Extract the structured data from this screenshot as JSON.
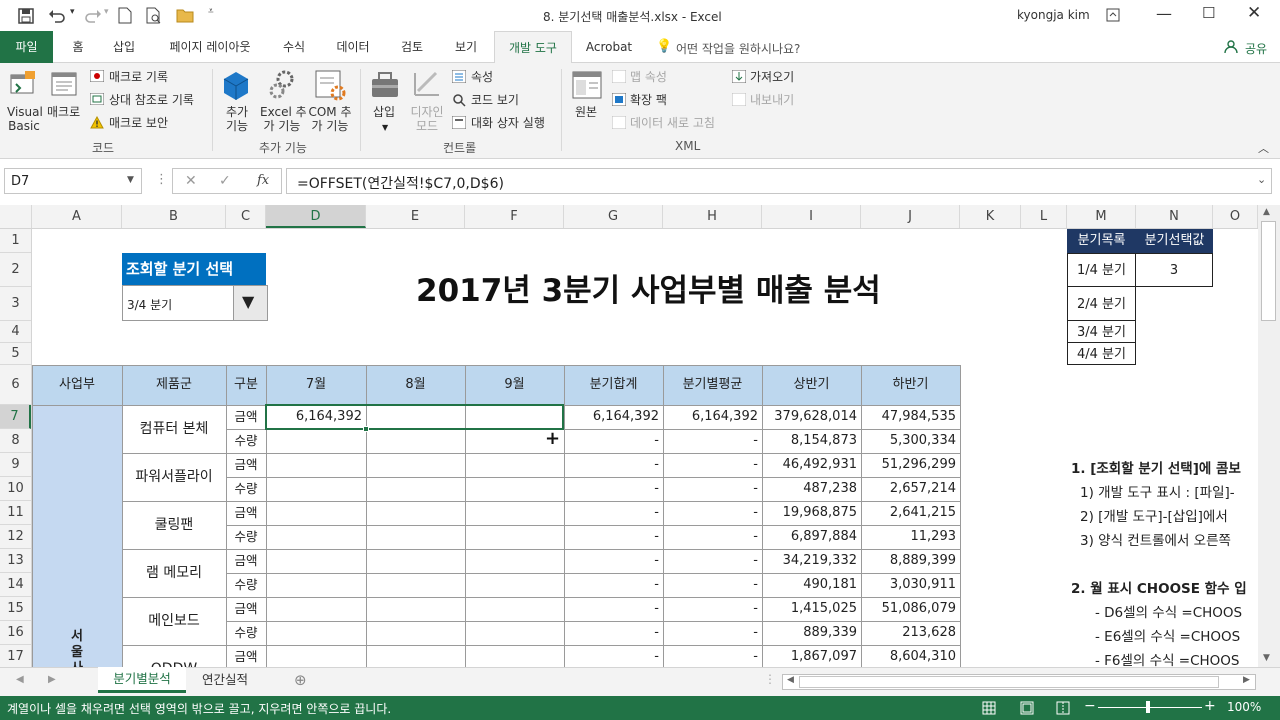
{
  "title": {
    "file": "8. 분기선택 매출분석.xlsx  -  Excel",
    "user": "kyongja kim"
  },
  "tabs": [
    "파일",
    "홈",
    "삽입",
    "페이지 레이아웃",
    "수식",
    "데이터",
    "검토",
    "보기",
    "개발 도구",
    "Acrobat"
  ],
  "tell_me": "어떤 작업을 원하시나요?",
  "share": "공유",
  "ribbon": {
    "vb": [
      "Visual",
      "Basic"
    ],
    "macro": "매크로",
    "rec_macro": "매크로 기록",
    "rel_ref": "상대 참조로 기록",
    "macro_sec": "매크로 보안",
    "grp_code": "코드",
    "addins": [
      "추가",
      "기능"
    ],
    "excel_addins": [
      "Excel 추",
      "가 기능"
    ],
    "com_addins": [
      "COM 추",
      "가 기능"
    ],
    "grp_addins": "추가 기능",
    "insert": "삽입",
    "design": [
      "디자인",
      "모드"
    ],
    "props": "속성",
    "view_code": "코드 보기",
    "run_dialog": "대화 상자 실행",
    "grp_controls": "컨트롤",
    "source": "원본",
    "map_props": "맵 속성",
    "ext_packs": "확장 팩",
    "refresh": "데이터 새로 고침",
    "import": "가져오기",
    "export": "내보내기",
    "grp_xml": "XML"
  },
  "namebox": "D7",
  "formula": "=OFFSET(연간실적!$C7,0,D$6)",
  "columns": [
    "A",
    "B",
    "C",
    "D",
    "E",
    "F",
    "G",
    "H",
    "I",
    "J",
    "K",
    "L",
    "M",
    "N",
    "O"
  ],
  "rows": [
    "1",
    "2",
    "3",
    "4",
    "5",
    "6",
    "7",
    "8",
    "9",
    "10",
    "11",
    "12",
    "13",
    "14",
    "15",
    "16",
    "17"
  ],
  "sheet": {
    "title": "2017년 3분기 사업부별 매출 분석",
    "combo_label": "조회할 분기 선택",
    "combo_value": "3/4 분기",
    "headers": [
      "사업부",
      "제품군",
      "구분",
      "7월",
      "8월",
      "9월",
      "분기합계",
      "분기별평균",
      "상반기",
      "하반기"
    ],
    "division": "서울사",
    "products": [
      "컴퓨터 본체",
      "파워서플라이",
      "쿨링팬",
      "램 메모리",
      "메인보드",
      "ODDW"
    ],
    "kinds": [
      "금액",
      "수량"
    ],
    "data": [
      [
        "6,164,392",
        "",
        "",
        "6,164,392",
        "6,164,392",
        "379,628,014",
        "47,984,535"
      ],
      [
        "",
        "",
        "",
        "-",
        "-",
        "8,154,873",
        "5,300,334"
      ],
      [
        "",
        "",
        "",
        "-",
        "-",
        "46,492,931",
        "51,296,299"
      ],
      [
        "",
        "",
        "",
        "-",
        "-",
        "487,238",
        "2,657,214"
      ],
      [
        "",
        "",
        "",
        "-",
        "-",
        "19,968,875",
        "2,641,215"
      ],
      [
        "",
        "",
        "",
        "-",
        "-",
        "6,897,884",
        "11,293"
      ],
      [
        "",
        "",
        "",
        "-",
        "-",
        "34,219,332",
        "8,889,399"
      ],
      [
        "",
        "",
        "",
        "-",
        "-",
        "490,181",
        "3,030,911"
      ],
      [
        "",
        "",
        "",
        "-",
        "-",
        "1,415,025",
        "51,086,079"
      ],
      [
        "",
        "",
        "",
        "-",
        "-",
        "889,339",
        "213,628"
      ],
      [
        "",
        "",
        "",
        "-",
        "-",
        "1,867,097",
        "8,604,310"
      ]
    ],
    "list_header": [
      "분기목록",
      "분기선택값"
    ],
    "list": [
      "1/4 분기",
      "2/4 분기",
      "3/4 분기",
      "4/4 분기"
    ],
    "selected_value": "3",
    "notes": [
      "1. [조회할 분기 선택]에 콤보",
      "1) 개발 도구 표시 : [파일]-",
      "2) [개발 도구]-[삽입]에서",
      "3) 양식 컨트롤에서 오른쪽",
      "2. 월 표시 CHOOSE 함수 입",
      "- D6셀의 수식 =CHOOS",
      "- E6셀의 수식 =CHOOS",
      "- F6셀의 수식 =CHOOS"
    ]
  },
  "sheet_tabs": [
    "분기별분석",
    "연간실적"
  ],
  "status": "계열이나 셀을 채우려면 선택 영역의 밖으로 끌고, 지우려면 안쪽으로 끕니다.",
  "zoom": "100%",
  "colors": {
    "accent": "#217346",
    "header_fill": "#bdd7ee",
    "division_fill": "#c5d9f1",
    "combo_label": "#0070c0",
    "list_header": "#1f3864"
  }
}
